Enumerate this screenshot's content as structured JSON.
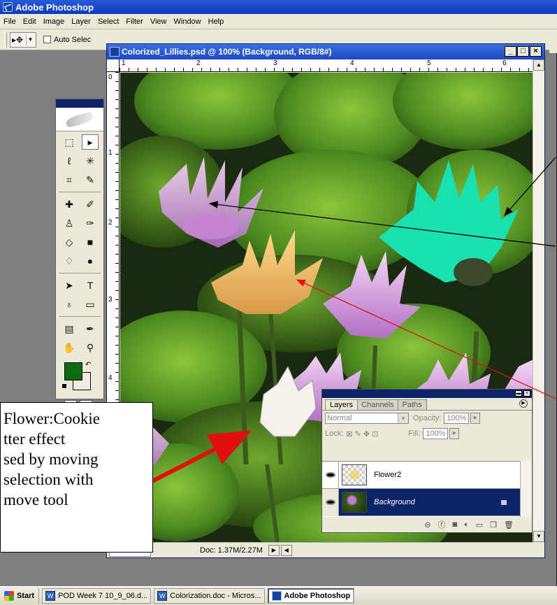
{
  "app": {
    "title": "Adobe Photoshop",
    "menu": [
      "File",
      "Edit",
      "Image",
      "Layer",
      "Select",
      "Filter",
      "View",
      "Window",
      "Help"
    ]
  },
  "options_bar": {
    "auto_select_label": "Auto Selec"
  },
  "document": {
    "title": "Colorized_Lillies.psd @ 100% (Background, RGB/8#)",
    "ruler_top_numbers": [
      "1",
      "2",
      "3",
      "4",
      "5",
      "6"
    ],
    "ruler_left_numbers": [
      "0",
      "1",
      "2",
      "3",
      "4"
    ],
    "status_doc": "Doc: 1.37M/2.27M",
    "window_buttons": [
      "_",
      "□",
      "×"
    ]
  },
  "toolbox": {
    "foreground_color": "#0f6b10",
    "background_color": "#f0ede0",
    "tools": [
      "marquee-icon",
      "move-icon",
      "lasso-icon",
      "magic-wand-icon",
      "crop-icon",
      "slice-icon",
      "healing-brush-icon",
      "brush-icon",
      "clone-stamp-icon",
      "history-brush-icon",
      "eraser-icon",
      "gradient-icon",
      "blur-icon",
      "dodge-icon",
      "path-selection-icon",
      "type-icon",
      "pen-icon",
      "shape-icon",
      "notes-icon",
      "eyedropper-icon",
      "hand-icon",
      "zoom-icon"
    ]
  },
  "layers_palette": {
    "tabs": [
      "Layers",
      "Channels",
      "Paths"
    ],
    "blend_mode": "Normal",
    "opacity_label": "Opacity:",
    "opacity_value": "100%",
    "lock_label": "Lock:",
    "fill_label": "Fill:",
    "fill_value": "100%",
    "layers": [
      {
        "name": "Flower2",
        "selected": false
      },
      {
        "name": "Background",
        "selected": true
      }
    ]
  },
  "callout": {
    "lines": [
      "Flower:Cookie",
      "tter effect",
      "sed by moving",
      " selection with",
      " move tool"
    ]
  },
  "taskbar": {
    "start_label": "Start",
    "tasks": [
      "POD Week 7  10_9_06.d...",
      "Colorization.doc - Micros...",
      "Adobe Photoshop"
    ]
  },
  "colors": {
    "title_bar": "#0b3bbd",
    "selection_highlight": "#0a246a",
    "teal_shape": "#19e0b0",
    "arrow_black": "#000000",
    "arrow_red": "#e01010"
  }
}
